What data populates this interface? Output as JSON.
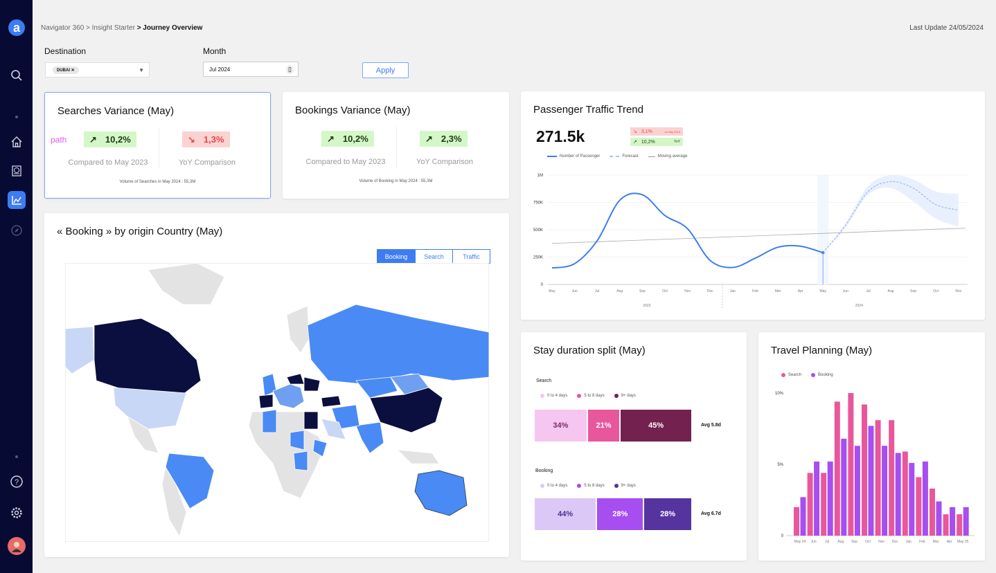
{
  "sidebar": {
    "logo": "a",
    "icons": [
      "search-icon",
      "home-icon",
      "globe-icon",
      "chart-icon",
      "compass-icon",
      "help-icon",
      "settings-icon",
      "avatar"
    ]
  },
  "breadcrumb": {
    "part1": "Navigator 360 > Insight Starter ",
    "current": "> Journey Overview"
  },
  "last_update": "Last Update 24/05/2024",
  "filters": {
    "destination_label": "Destination",
    "destination_chip": "DUBAI",
    "month_label": "Month",
    "month_value": "Jul 2024",
    "apply": "Apply"
  },
  "searches": {
    "title": "Searches Variance (May)",
    "annotation": "path",
    "v1": "10,2%",
    "v1_label": "Compared to May 2023",
    "v2": "1,3%",
    "v2_label": "YoY Comparison",
    "footer": "Volume of Searches in May 2024 : 55,3M"
  },
  "bookings": {
    "title": "Bookings Variance (May)",
    "v1": "10,2%",
    "v1_label": "Compared to May 2023",
    "v2": "2,3%",
    "v2_label": "YoY Comparison",
    "footer": "Volume of Booking in May 2024 : 55,3M"
  },
  "map": {
    "title": "« Booking » by origin Country (May)",
    "tabs": [
      "Booking",
      "Search",
      "Traffic"
    ]
  },
  "traffic": {
    "title": "Passenger Traffic Trend",
    "total": "271.5k",
    "badge1": "3,1%",
    "badge1_label": "vs May 2023",
    "badge2": "10,2%",
    "badge2_label": "YoY"
  },
  "stay": {
    "title": "Stay duration split (May)",
    "search_label": "Search",
    "booking_label": "Booking",
    "legend": [
      "0 to 4 days",
      "5 to 8 days",
      "9+ days"
    ],
    "search": [
      "34%",
      "21%",
      "45%"
    ],
    "search_avg": "Avg 5.8d",
    "booking": [
      "44%",
      "28%",
      "28%"
    ],
    "booking_avg": "Avg 6.7d"
  },
  "travel": {
    "title": "Travel Planning (May)"
  },
  "colors": {
    "accent": "#3d7cf2",
    "sidebar": "#070b33"
  },
  "chart_data": [
    {
      "type": "line",
      "title": "Passenger Traffic Trend",
      "legend": [
        "Number of Passenger",
        "Forecast",
        "Moving average"
      ],
      "x": [
        "May",
        "Jun",
        "Jul",
        "Aug",
        "Sep",
        "Oct",
        "Nov",
        "Dec",
        "Jan",
        "Feb",
        "Mar",
        "Apr",
        "May",
        "Jun",
        "Jul",
        "Aug",
        "Sep",
        "Oct",
        "Nov"
      ],
      "years": [
        "2023",
        "2024"
      ],
      "yticks": [
        "0",
        "250K",
        "500K",
        "750K",
        "1M"
      ],
      "ylim": [
        0,
        1000000
      ],
      "passengers": [
        150000,
        190000,
        400000,
        770000,
        820000,
        630000,
        510000,
        220000,
        155000,
        240000,
        340000,
        350000,
        290000
      ],
      "forecast": [
        290000,
        540000,
        850000,
        940000,
        880000,
        730000,
        680000
      ],
      "forecast_upper": [
        290000,
        560000,
        900000,
        1000000,
        960000,
        850000,
        830000
      ],
      "forecast_lower": [
        290000,
        520000,
        820000,
        880000,
        760000,
        600000,
        530000
      ],
      "moving_average": [
        375000,
        515000
      ]
    },
    {
      "type": "bar",
      "title": "Travel Planning (May)",
      "categories": [
        "May 24",
        "Jun",
        "Jul",
        "Aug",
        "Sep",
        "Oct",
        "Nov",
        "Dec",
        "Jan",
        "Feb",
        "Mar",
        "Apr",
        "May 25"
      ],
      "yticks": [
        "0",
        "5%",
        "10%"
      ],
      "ylim": [
        0,
        10
      ],
      "series": [
        {
          "name": "Search",
          "color": "#e8579c",
          "values": [
            2.0,
            4.4,
            4.4,
            9.4,
            10.0,
            9.2,
            8.1,
            8.1,
            5.9,
            4.1,
            3.3,
            1.5,
            1.5
          ]
        },
        {
          "name": "Booking",
          "color": "#a64ef0",
          "values": [
            2.7,
            5.2,
            5.2,
            6.8,
            6.3,
            7.7,
            6.3,
            5.8,
            5.1,
            5.2,
            2.4,
            2.0,
            2.0
          ]
        }
      ]
    }
  ]
}
